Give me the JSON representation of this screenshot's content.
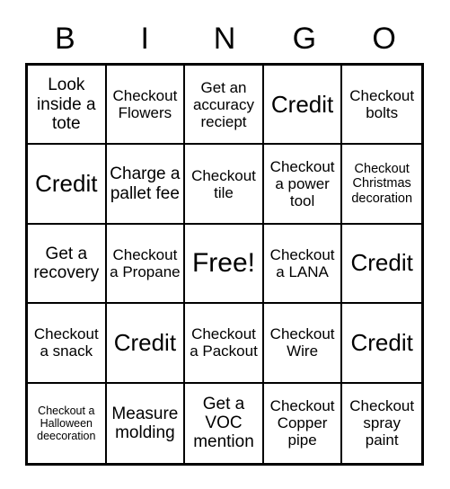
{
  "card": {
    "header_letters": [
      "B",
      "I",
      "N",
      "G",
      "O"
    ],
    "grid": {
      "rows": [
        [
          {
            "text": "Look inside a tote",
            "size": "size-md"
          },
          {
            "text": "Checkout Flowers",
            "size": "size-sm"
          },
          {
            "text": "Get an accuracy reciept",
            "size": "size-sm"
          },
          {
            "text": "Credit",
            "size": "size-lg"
          },
          {
            "text": "Checkout bolts",
            "size": "size-sm"
          }
        ],
        [
          {
            "text": "Credit",
            "size": "size-lg"
          },
          {
            "text": "Charge a pallet fee",
            "size": "size-md"
          },
          {
            "text": "Checkout tile",
            "size": "size-sm"
          },
          {
            "text": "Checkout a power tool",
            "size": "size-sm"
          },
          {
            "text": "Checkout Christmas decoration",
            "size": "size-xs"
          }
        ],
        [
          {
            "text": "Get a recovery",
            "size": "size-md"
          },
          {
            "text": "Checkout a Propane",
            "size": "size-sm"
          },
          {
            "text": "Free!",
            "size": "size-xl"
          },
          {
            "text": "Checkout a LANA",
            "size": "size-sm"
          },
          {
            "text": "Credit",
            "size": "size-lg"
          }
        ],
        [
          {
            "text": "Checkout a snack",
            "size": "size-sm"
          },
          {
            "text": "Credit",
            "size": "size-lg"
          },
          {
            "text": "Checkout a Packout",
            "size": "size-sm"
          },
          {
            "text": "Checkout Wire",
            "size": "size-sm"
          },
          {
            "text": "Credit",
            "size": "size-lg"
          }
        ],
        [
          {
            "text": "Checkout a Halloween deecoration",
            "size": "size-xxs"
          },
          {
            "text": "Measure molding",
            "size": "size-md"
          },
          {
            "text": "Get a VOC mention",
            "size": "size-md"
          },
          {
            "text": "Checkout Copper pipe",
            "size": "size-sm"
          },
          {
            "text": "Checkout spray paint",
            "size": "size-sm"
          }
        ]
      ]
    },
    "colors": {
      "border": "#000000",
      "cell_background": "#ffffff",
      "text": "#000000"
    }
  }
}
